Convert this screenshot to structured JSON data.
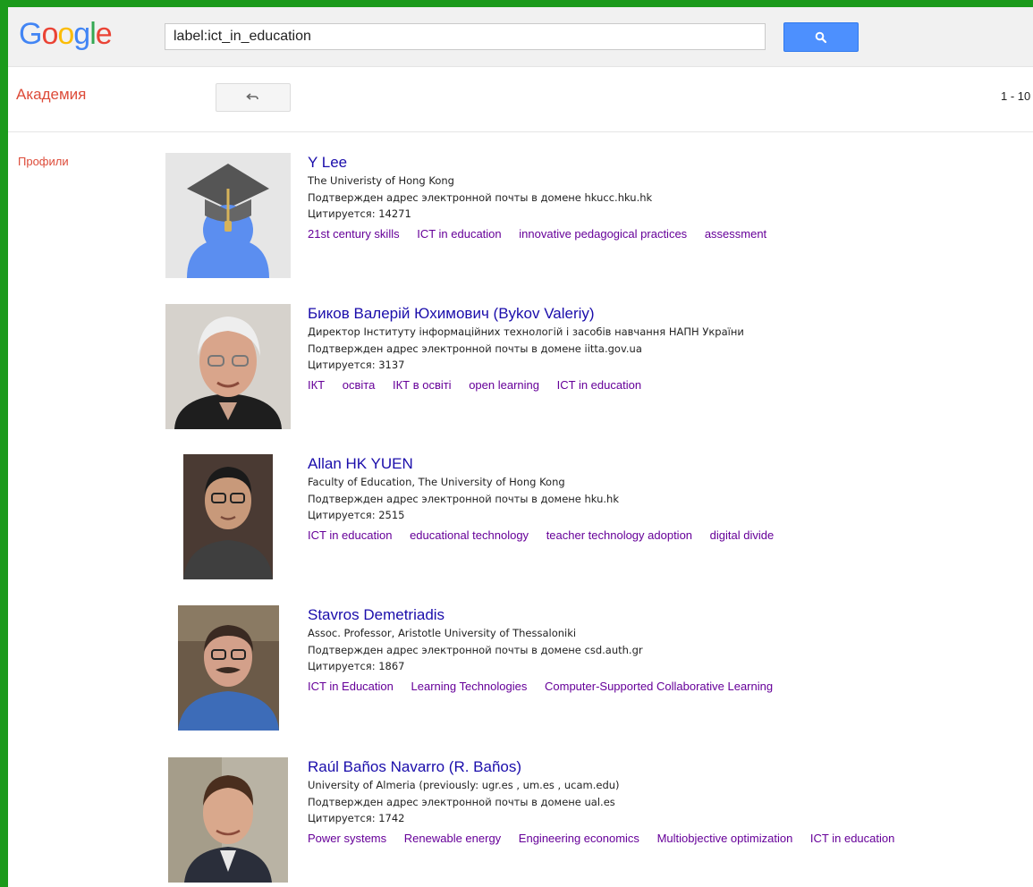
{
  "header": {
    "logo_letters": [
      {
        "char": "G",
        "color": "#4285f4"
      },
      {
        "char": "o",
        "color": "#ea4335"
      },
      {
        "char": "o",
        "color": "#fbbc05"
      },
      {
        "char": "g",
        "color": "#4285f4"
      },
      {
        "char": "l",
        "color": "#34a853"
      },
      {
        "char": "e",
        "color": "#ea4335"
      }
    ],
    "search_value": "label:ict_in_education",
    "search_icon": "search-icon"
  },
  "subbar": {
    "title": "Академия",
    "back_icon": "back-arrow-icon",
    "range": "1 - 10"
  },
  "left_nav": {
    "profiles_label": "Профили"
  },
  "profiles": [
    {
      "name": "Y Lee",
      "affiliation": "The Univeristy of Hong Kong",
      "email": "Подтвержден адрес электронной почты в домене hkucc.hku.hk",
      "cited": "Цитируется: 14271",
      "tags": [
        "21st century skills",
        "ICT in education",
        "innovative pedagogical practices",
        "assessment"
      ],
      "photo": "placeholder-graduate-avatar"
    },
    {
      "name": "Биков Валерій Юхимович (Bykov Valeriy)",
      "affiliation": "Директор Інституту інформаційних технологій і засобів навчання НАПН України",
      "email": "Подтвержден адрес электронной почты в домене iitta.gov.ua",
      "cited": "Цитируется: 3137",
      "tags": [
        "ІКТ",
        "освіта",
        "ІКТ в освіті",
        "open learning",
        "ICT in education"
      ],
      "photo": "portrait"
    },
    {
      "name": "Allan HK YUEN",
      "affiliation": "Faculty of Education, The University of Hong Kong",
      "email": "Подтвержден адрес электронной почты в домене hku.hk",
      "cited": "Цитируется: 2515",
      "tags": [
        "ICT in education",
        "educational technology",
        "teacher technology adoption",
        "digital divide"
      ],
      "photo": "portrait"
    },
    {
      "name": "Stavros Demetriadis",
      "affiliation": "Assoc. Professor, Aristotle University of Thessaloniki",
      "email": "Подтвержден адрес электронной почты в домене csd.auth.gr",
      "cited": "Цитируется: 1867",
      "tags": [
        "ICT in Education",
        "Learning Technologies",
        "Computer-Supported Collaborative Learning"
      ],
      "photo": "portrait"
    },
    {
      "name": "Raúl Baños Navarro (R. Baños)",
      "affiliation": "University of Almeria (previously: ugr.es , um.es , ucam.edu)",
      "email": "Подтвержден адрес электронной почты в домене ual.es",
      "cited": "Цитируется: 1742",
      "tags": [
        "Power systems",
        "Renewable energy",
        "Engineering economics",
        "Multiobjective optimization",
        "ICT in education"
      ],
      "photo": "portrait"
    }
  ]
}
